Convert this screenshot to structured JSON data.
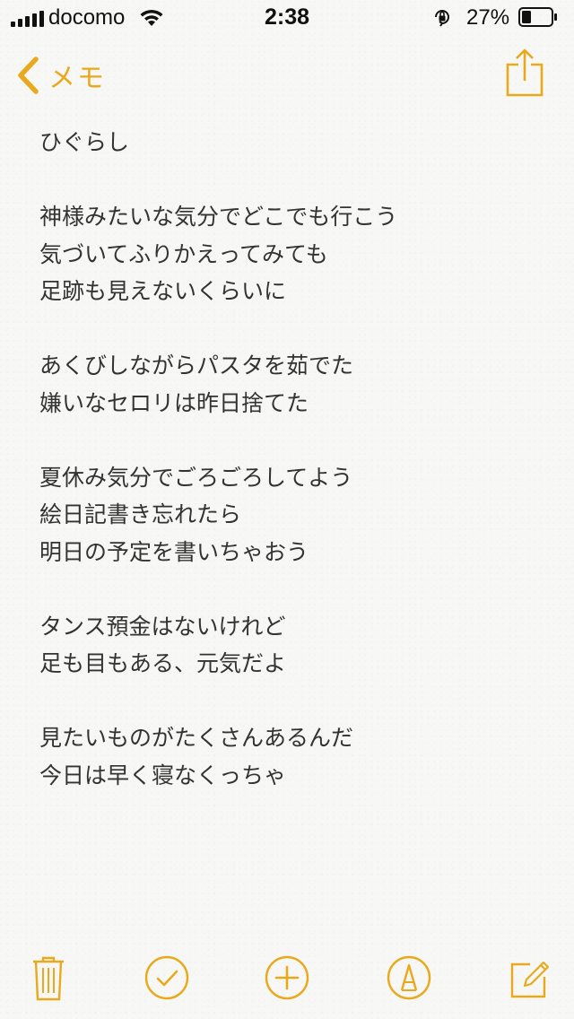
{
  "status_bar": {
    "carrier": "docomo",
    "time": "2:38",
    "battery_percent": "27%",
    "battery_level": 0.27,
    "icons": [
      "signal-icon",
      "wifi-icon",
      "orientation-lock-icon",
      "battery-icon"
    ]
  },
  "nav": {
    "back_label": "メモ",
    "back_icon": "chevron-left-icon",
    "share_icon": "share-icon",
    "accent_color": "#e8a91d"
  },
  "note": {
    "lines": [
      "ひぐらし",
      "",
      "神様みたいな気分でどこでも行こう",
      "気づいてふりかえってみても",
      "足跡も見えないくらいに",
      "",
      "あくびしながらパスタを茹でた",
      "嫌いなセロリは昨日捨てた",
      "",
      "夏休み気分でごろごろしてよう",
      "絵日記書き忘れたら",
      "明日の予定を書いちゃおう",
      "",
      "タンス預金はないけれど",
      "足も目もある、元気だよ",
      "",
      "見たいものがたくさんあるんだ",
      "今日は早く寝なくっちゃ"
    ]
  },
  "toolbar": {
    "items": [
      "trash-icon",
      "checklist-icon",
      "add-icon",
      "markup-icon",
      "compose-icon"
    ]
  }
}
